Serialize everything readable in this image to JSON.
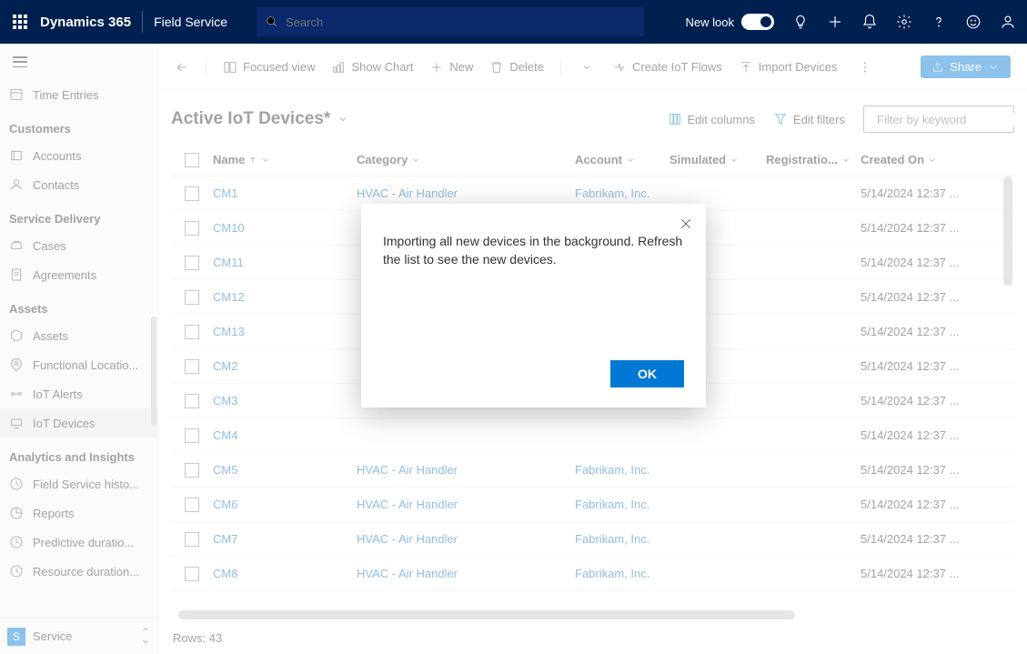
{
  "topbar": {
    "brand": "Dynamics 365",
    "app": "Field Service",
    "search_placeholder": "Search",
    "new_look": "New look"
  },
  "sidebar": {
    "time_entries": "Time Entries",
    "groups": [
      {
        "header": "Customers",
        "items": [
          "Accounts",
          "Contacts"
        ]
      },
      {
        "header": "Service Delivery",
        "items": [
          "Cases",
          "Agreements"
        ]
      },
      {
        "header": "Assets",
        "items": [
          "Assets",
          "Functional Locatio...",
          "IoT Alerts",
          "IoT Devices"
        ]
      },
      {
        "header": "Analytics and Insights",
        "items": [
          "Field Service histo...",
          "Reports",
          "Predictive duratio...",
          "Resource duration..."
        ]
      }
    ],
    "selected": "IoT Devices",
    "footer": {
      "badge": "S",
      "label": "Service"
    }
  },
  "commands": {
    "focused": "Focused view",
    "chart": "Show Chart",
    "new": "New",
    "delete": "Delete",
    "iotflows": "Create IoT Flows",
    "import": "Import Devices",
    "share": "Share"
  },
  "view": {
    "title": "Active IoT Devices*",
    "edit_columns": "Edit columns",
    "edit_filters": "Edit filters",
    "filter_placeholder": "Filter by keyword"
  },
  "grid": {
    "columns": {
      "name": "Name",
      "category": "Category",
      "account": "Account",
      "simulated": "Simulated",
      "registration": "Registratio...",
      "created": "Created On"
    },
    "rows": [
      {
        "name": "CM1",
        "category": "HVAC - Air Handler",
        "account": "Fabrikam, Inc.",
        "created": "5/14/2024 12:37 ..."
      },
      {
        "name": "CM10",
        "category": "",
        "account": "",
        "created": "5/14/2024 12:37 ..."
      },
      {
        "name": "CM11",
        "category": "",
        "account": "",
        "created": "5/14/2024 12:37 ..."
      },
      {
        "name": "CM12",
        "category": "",
        "account": "",
        "created": "5/14/2024 12:37 ..."
      },
      {
        "name": "CM13",
        "category": "",
        "account": "",
        "created": "5/14/2024 12:37 ..."
      },
      {
        "name": "CM2",
        "category": "",
        "account": "",
        "created": "5/14/2024 12:37 ..."
      },
      {
        "name": "CM3",
        "category": "",
        "account": "",
        "created": "5/14/2024 12:37 ..."
      },
      {
        "name": "CM4",
        "category": "",
        "account": "",
        "created": "5/14/2024 12:37 ..."
      },
      {
        "name": "CM5",
        "category": "HVAC - Air Handler",
        "account": "Fabrikam, Inc.",
        "created": "5/14/2024 12:37 ..."
      },
      {
        "name": "CM6",
        "category": "HVAC - Air Handler",
        "account": "Fabrikam, Inc.",
        "created": "5/14/2024 12:37 ..."
      },
      {
        "name": "CM7",
        "category": "HVAC - Air Handler",
        "account": "Fabrikam, Inc.",
        "created": "5/14/2024 12:37 ..."
      },
      {
        "name": "CM8",
        "category": "HVAC - Air Handler",
        "account": "Fabrikam, Inc.",
        "created": "5/14/2024 12:37 ..."
      }
    ],
    "footer": "Rows: 43"
  },
  "modal": {
    "message": "Importing all new devices in the background. Refresh the list to see the new devices.",
    "ok": "OK"
  }
}
